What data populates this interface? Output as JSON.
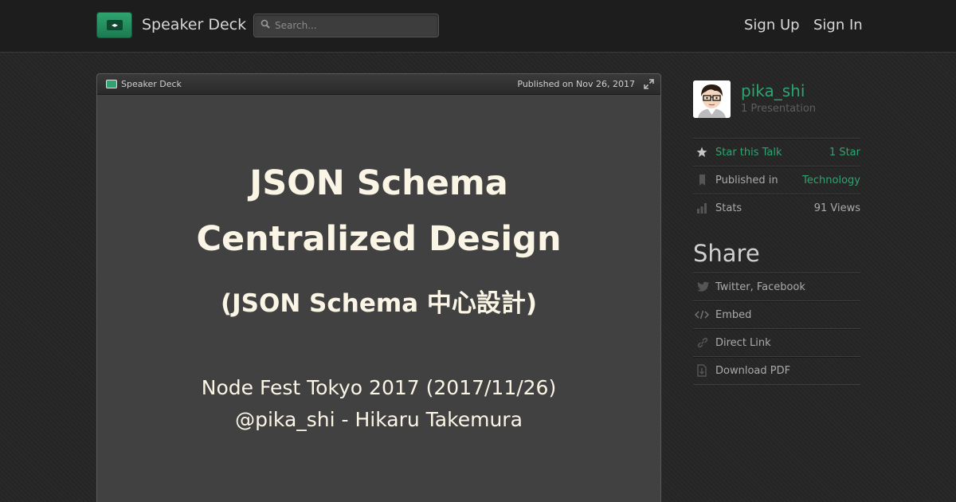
{
  "header": {
    "brand": "Speaker Deck",
    "search_placeholder": "Search...",
    "sign_up": "Sign Up",
    "sign_in": "Sign In"
  },
  "player": {
    "brand": "Speaker Deck",
    "published": "Published on Nov 26, 2017",
    "slide": {
      "title_line1": "JSON Schema",
      "title_line2": "Centralized Design",
      "subtitle": "(JSON Schema 中心設計)",
      "event": "Node Fest Tokyo 2017 (2017/11/26)",
      "author": "@pika_shi  -  Hikaru Takemura"
    }
  },
  "sidebar": {
    "username": "pika_shi",
    "presentations": "1 Presentation",
    "star_label": "Star this Talk",
    "star_count": "1 Star",
    "published_label": "Published in",
    "category": "Technology",
    "stats_label": "Stats",
    "views": "91 Views",
    "share_heading": "Share",
    "share_items": [
      "Twitter, Facebook",
      "Embed",
      "Direct Link",
      "Download PDF"
    ]
  },
  "colors": {
    "accent": "#2fa470",
    "background": "#262626",
    "slide_bg": "#414141",
    "slide_text": "#fbf5e6"
  },
  "icons": [
    "search-icon",
    "star-icon",
    "bookmark-icon",
    "stats-icon",
    "twitter-icon",
    "embed-icon",
    "link-icon",
    "download-icon",
    "expand-icon"
  ]
}
